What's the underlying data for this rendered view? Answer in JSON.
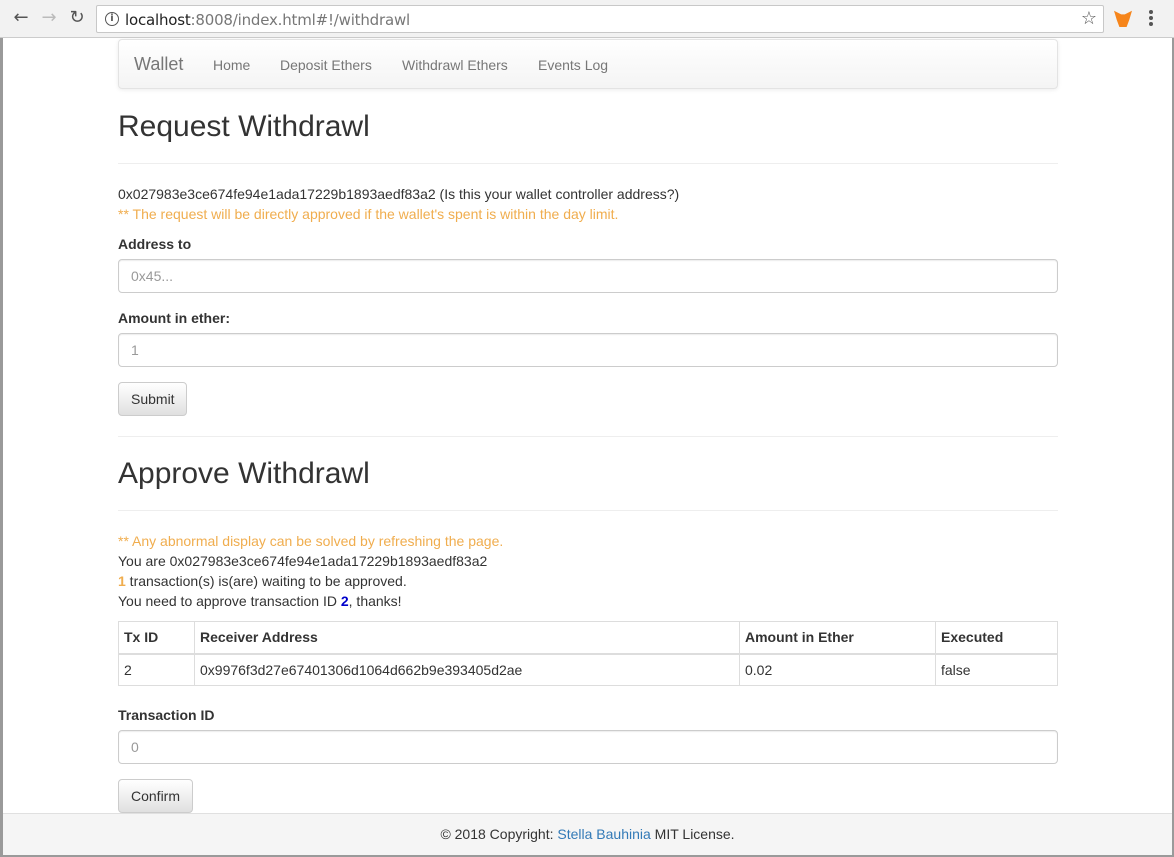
{
  "browser": {
    "back_icon": "←",
    "forward_icon": "→",
    "reload_icon": "↻",
    "url_host": "localhost",
    "url_rest": ":8008/index.html#!/withdrawl",
    "bookmark_icon": "☆"
  },
  "navbar": {
    "brand": "Wallet",
    "links": [
      "Home",
      "Deposit Ethers",
      "Withdrawl Ethers",
      "Events Log"
    ]
  },
  "request": {
    "title": "Request Withdrawl",
    "address_line": "0x027983e3ce674fe94e1ada17229b1893aedf83a2 (Is this your wallet controller address?)",
    "note": "** The request will be directly approved if the wallet's spent is within the day limit.",
    "address_label": "Address to",
    "address_placeholder": "0x45...",
    "amount_label": "Amount in ether:",
    "amount_placeholder": "1",
    "submit_label": "Submit"
  },
  "approve": {
    "title": "Approve Withdrawl",
    "note": "** Any abnormal display can be solved by refreshing the page.",
    "you_are": "You are 0x027983e3ce674fe94e1ada17229b1893aedf83a2",
    "waiting_count": "1",
    "waiting_text": " transaction(s) is(are) waiting to be approved.",
    "need_prefix": "You need to approve transaction ID ",
    "need_id": "2",
    "need_suffix": ", thanks!",
    "table": {
      "headers": [
        "Tx ID",
        "Receiver Address",
        "Amount in Ether",
        "Executed"
      ],
      "rows": [
        [
          "2",
          "0x9976f3d27e67401306d1064d662b9e393405d2ae",
          "0.02",
          "false"
        ]
      ]
    },
    "txid_label": "Transaction ID",
    "txid_placeholder": "0",
    "confirm_label": "Confirm"
  },
  "footer": {
    "prefix": "© 2018 Copyright: ",
    "link": "Stella Bauhinia",
    "suffix": " MIT License."
  },
  "colors": {
    "warning": "#f0ad4e",
    "link": "#337ab7",
    "id_highlight": "#0000cc"
  }
}
